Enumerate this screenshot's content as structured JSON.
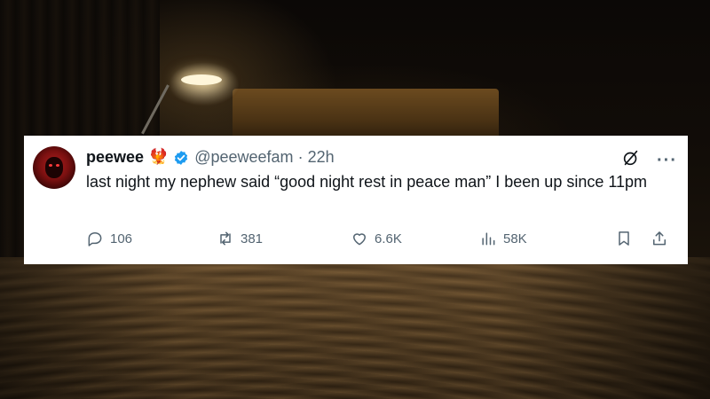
{
  "tweet": {
    "display_name": "peewee",
    "name_emojis": "🐦‍🔥",
    "handle": "@peeweefam",
    "separator": "·",
    "time": "22h",
    "text": "last night my nephew said “good night rest in peace man” I been up since 11pm",
    "verified": true,
    "accent_color": "#1d9bf0"
  },
  "metrics": {
    "replies": "106",
    "reposts": "381",
    "likes": "6.6K",
    "views": "58K"
  },
  "icons": {
    "reply": "reply-icon",
    "repost": "repost-icon",
    "like": "heart-icon",
    "views": "views-chart-icon",
    "bookmark": "bookmark-icon",
    "share": "share-icon",
    "grok": "grok-icon",
    "more": "more-icon"
  }
}
